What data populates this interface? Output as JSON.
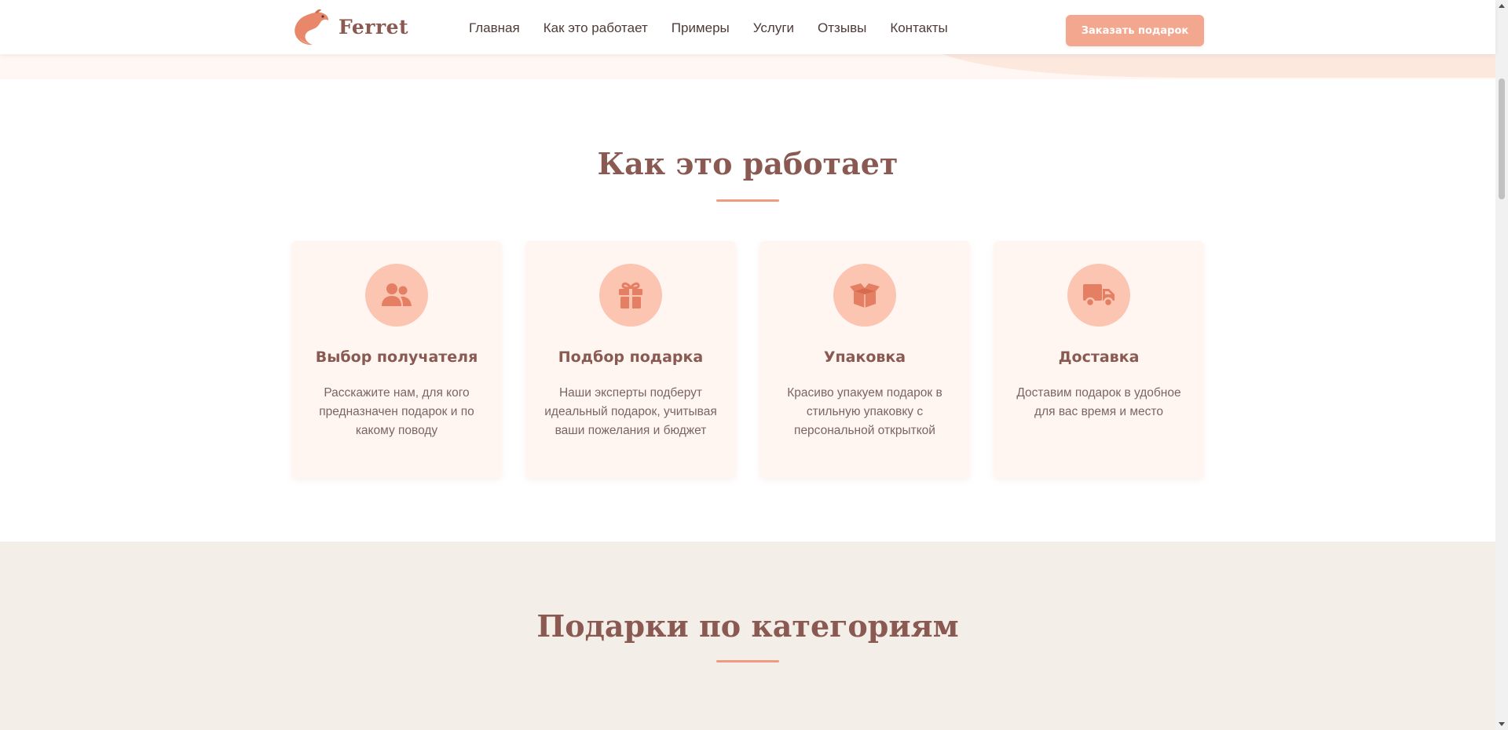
{
  "header": {
    "logo_text": "Ferret",
    "logo_icon": "ferret-logo-icon",
    "nav": [
      {
        "label": "Главная"
      },
      {
        "label": "Как это работает"
      },
      {
        "label": "Примеры"
      },
      {
        "label": "Услуги"
      },
      {
        "label": "Отзывы"
      },
      {
        "label": "Контакты"
      }
    ],
    "cta_label": "Заказать подарок"
  },
  "how_it_works": {
    "title": "Как это работает",
    "steps": [
      {
        "icon": "users-icon",
        "title": "Выбор получателя",
        "desc": "Расскажите нам, для кого предназначен подарок и по какому поводу"
      },
      {
        "icon": "gift-icon",
        "title": "Подбор подарка",
        "desc": "Наши эксперты подберут идеальный подарок, учитывая ваши пожелания и бюджет"
      },
      {
        "icon": "box-open-icon",
        "title": "Упаковка",
        "desc": "Красиво упакуем подарок в стильную упаковку с персональной открыткой"
      },
      {
        "icon": "truck-icon",
        "title": "Доставка",
        "desc": "Доставим подарок в удобное для вас время и место"
      }
    ]
  },
  "categories": {
    "title": "Подарки по категориям"
  },
  "colors": {
    "brand": "#8a5a52",
    "accent": "#f4a78f",
    "icon_bg": "#fbc5b1",
    "icon_fg": "#e57f63",
    "card_bg": "#fff6f2",
    "section_alt_bg": "#f4eee8"
  }
}
